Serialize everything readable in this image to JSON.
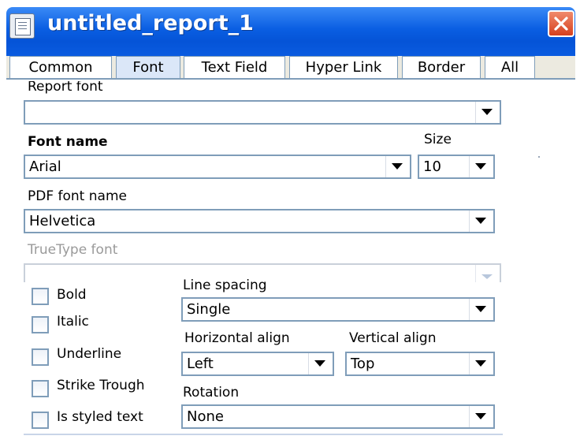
{
  "window": {
    "title": "untitled_report_1",
    "close_icon": "close-icon",
    "app_icon": "report-icon"
  },
  "tabs": [
    {
      "label": "Common",
      "active": false
    },
    {
      "label": "Font",
      "active": true
    },
    {
      "label": "Text Field",
      "active": false
    },
    {
      "label": "Hyper Link",
      "active": false
    },
    {
      "label": "Border",
      "active": false
    },
    {
      "label": "All",
      "active": false
    }
  ],
  "form": {
    "report_font": {
      "label": "Report font",
      "value": ""
    },
    "font_name": {
      "label": "Font name",
      "value": "Arial"
    },
    "size": {
      "label": "Size",
      "value": "10"
    },
    "pdf_font_name": {
      "label": "PDF font name",
      "value": "Helvetica"
    },
    "truetype_font": {
      "label": "TrueType font",
      "value": "",
      "disabled": true
    },
    "checkboxes": [
      {
        "label": "Bold",
        "checked": false
      },
      {
        "label": "Italic",
        "checked": false
      },
      {
        "label": "Underline",
        "checked": false
      },
      {
        "label": "Strike Trough",
        "checked": false
      },
      {
        "label": "Is styled text",
        "checked": false
      }
    ],
    "line_spacing": {
      "label": "Line spacing",
      "value": "Single"
    },
    "horizontal_align": {
      "label": "Horizontal align",
      "value": "Left"
    },
    "vertical_align": {
      "label": "Vertical align",
      "value": "Top"
    },
    "rotation": {
      "label": "Rotation",
      "value": "None"
    }
  },
  "colors": {
    "titlebar": "#0a5ee2",
    "close_button": "#d6401e",
    "input_border": "#7f9db9",
    "active_tab": "#dbe7f8"
  }
}
